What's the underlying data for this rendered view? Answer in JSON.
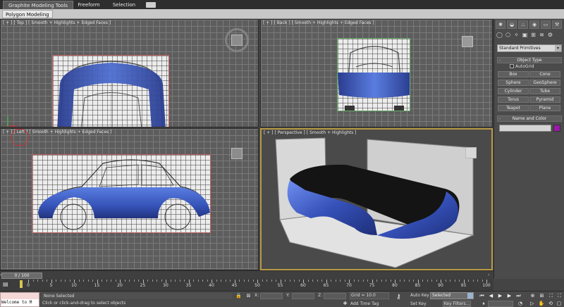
{
  "ribbon": {
    "tabs": [
      "Graphite Modeling Tools",
      "Freeform",
      "Selection"
    ],
    "panel_label": "Polygon Modeling"
  },
  "viewports": {
    "top": {
      "label": [
        "[ + ]",
        "[ Top ]",
        "[ Smooth + Highlights + Edged Faces ]"
      ]
    },
    "back": {
      "label": [
        "[ + ]",
        "[ Back ]",
        "[ Smooth + Highlights + Edged Faces ]"
      ]
    },
    "left": {
      "label": [
        "[ + ]",
        "[ Left ]",
        "[ Smooth + Highlights + Edged Faces ]"
      ]
    },
    "persp": {
      "label": [
        "[ + ]",
        "[ Perspective ]",
        "[ Smooth + Highlights ]"
      ]
    }
  },
  "command_panel": {
    "category": "Standard Primitives",
    "object_type_title": "Object Type",
    "autogrid": "AutoGrid",
    "buttons": [
      "Box",
      "Cone",
      "Sphere",
      "GeoSphere",
      "Cylinder",
      "Tube",
      "Torus",
      "Pyramid",
      "Teapot",
      "Plane"
    ],
    "name_color_title": "Name and Color",
    "color": "#9a1aa8"
  },
  "timeline": {
    "slider": "0 / 100",
    "ticks": [
      "0",
      "5",
      "10",
      "15",
      "20",
      "25",
      "30",
      "35",
      "40",
      "45",
      "50",
      "55",
      "60",
      "65",
      "70",
      "75",
      "80",
      "85",
      "90",
      "95",
      "100"
    ]
  },
  "status": {
    "maxscript": "Welcome to M",
    "selection": "None Selected",
    "prompt": "Click or click-and-drag to select objects",
    "x_label": "X:",
    "y_label": "Y:",
    "z_label": "Z:",
    "grid": "Grid = 10.0",
    "add_time_tag": "Add Time Tag",
    "auto_key": "Auto Key",
    "selected": "Selected",
    "set_key": "Set Key",
    "key_filters": "Key Filters...",
    "frame": "0"
  }
}
